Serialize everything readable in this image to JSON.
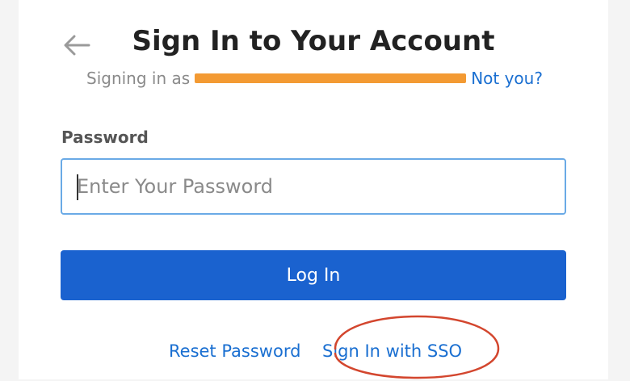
{
  "header": {
    "title": "Sign In to Your Account",
    "back_icon": "arrow-left-icon"
  },
  "account": {
    "signing_in_as": "Signing in as",
    "not_you": "Not you?"
  },
  "password": {
    "label": "Password",
    "value": "",
    "placeholder": "Enter Your Password"
  },
  "actions": {
    "login_label": "Log In",
    "reset_password": "Reset Password",
    "sso": "Sign In with SSO"
  },
  "colors": {
    "primary": "#1a62cf",
    "link": "#1a6fd1",
    "input_border": "#6aaae6",
    "redaction": "#f39a33",
    "annotation": "#d3462e"
  }
}
